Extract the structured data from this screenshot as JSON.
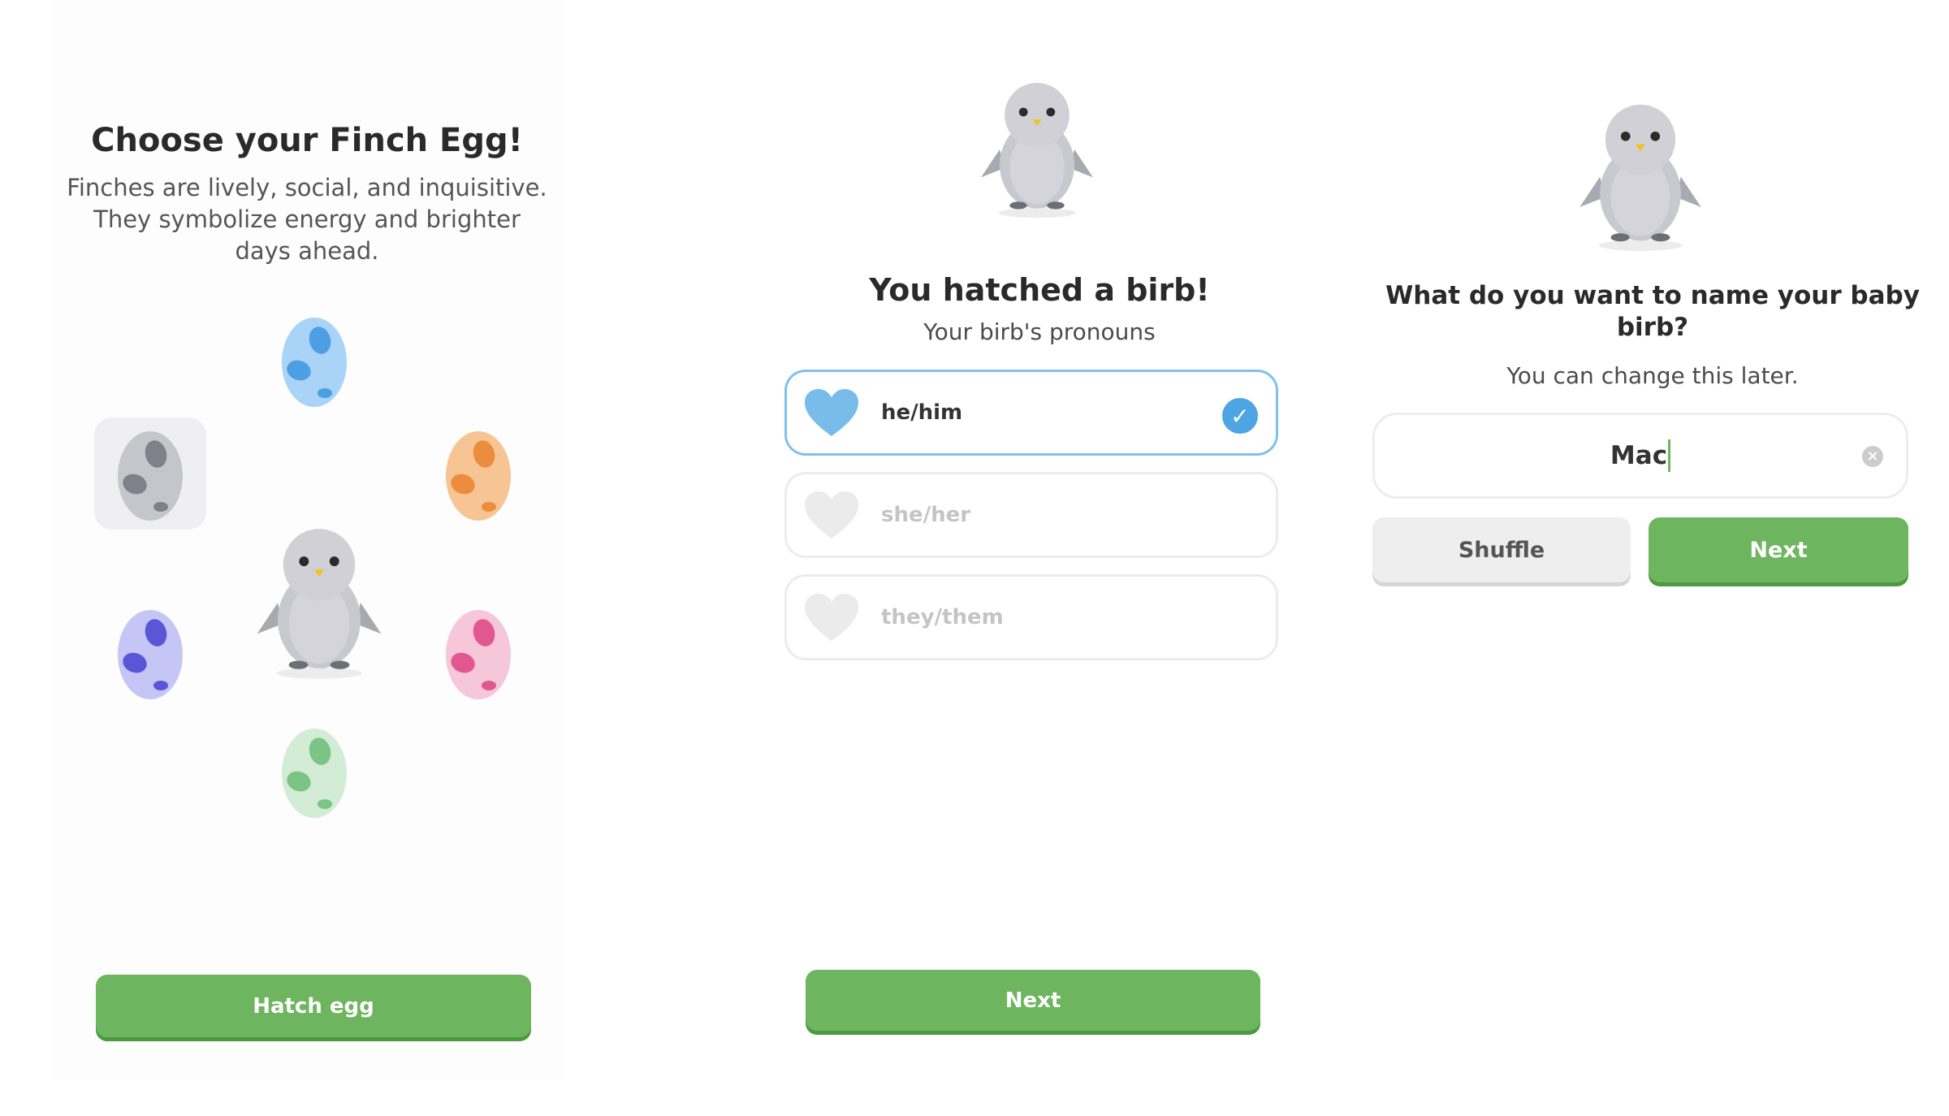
{
  "egg_screen": {
    "title": "Choose your Finch Egg!",
    "description": "Finches are lively, social, and inquisitive. They symbolize energy and brighter days ahead.",
    "eggs": [
      {
        "name": "blue",
        "color": "#a9d3f7",
        "spot": "#4d9fe3"
      },
      {
        "name": "gray",
        "color": "#c5c5cc",
        "spot": "#80808a"
      },
      {
        "name": "orange",
        "color": "#f7c593",
        "spot": "#ec8d3d"
      },
      {
        "name": "purple",
        "color": "#c5c6f6",
        "spot": "#5a56d8"
      },
      {
        "name": "pink",
        "color": "#f6c6d9",
        "spot": "#e2578f"
      },
      {
        "name": "green",
        "color": "#d3ecd5",
        "spot": "#7cc485"
      }
    ],
    "selected_egg": "gray",
    "hatch_button": "Hatch egg"
  },
  "pronoun_screen": {
    "title": "You hatched a birb!",
    "subtitle": "Your birb's pronouns",
    "options": [
      {
        "label": "he/him",
        "selected": true
      },
      {
        "label": "she/her",
        "selected": false
      },
      {
        "label": "they/them",
        "selected": false
      }
    ],
    "next_button": "Next"
  },
  "name_screen": {
    "title": "What do you want to name your baby birb?",
    "subtitle": "You can change this later.",
    "name_value": "Mac",
    "shuffle_button": "Shuffle",
    "next_button": "Next"
  },
  "colors": {
    "accent_green": "#6eb55f",
    "selection_blue": "#4da5e3",
    "bird_body": "#c8c8cf"
  }
}
